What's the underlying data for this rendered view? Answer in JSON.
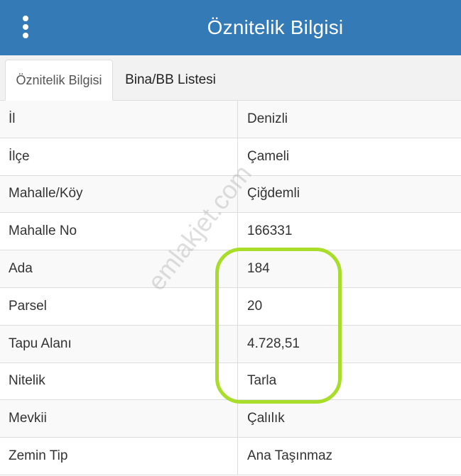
{
  "header": {
    "title": "Öznitelik Bilgisi",
    "menu_icon": "more-vertical-icon"
  },
  "tabs": [
    {
      "label": "Öznitelik Bilgisi",
      "active": true
    },
    {
      "label": "Bina/BB Listesi",
      "active": false
    }
  ],
  "attributes": [
    {
      "label": "İl",
      "value": "Denizli"
    },
    {
      "label": "İlçe",
      "value": "Çameli"
    },
    {
      "label": "Mahalle/Köy",
      "value": "Çiğdemli"
    },
    {
      "label": "Mahalle No",
      "value": "166331"
    },
    {
      "label": "Ada",
      "value": "184"
    },
    {
      "label": "Parsel",
      "value": "20"
    },
    {
      "label": "Tapu Alanı",
      "value": "4.728,51"
    },
    {
      "label": "Nitelik",
      "value": "Tarla"
    },
    {
      "label": "Mevkii",
      "value": "Çalılık"
    },
    {
      "label": "Zemin Tip",
      "value": "Ana Taşınmaz"
    }
  ],
  "watermark": "emlakjet.com",
  "colors": {
    "header_bg": "#337ab7",
    "highlight": "#a9dd2b"
  }
}
